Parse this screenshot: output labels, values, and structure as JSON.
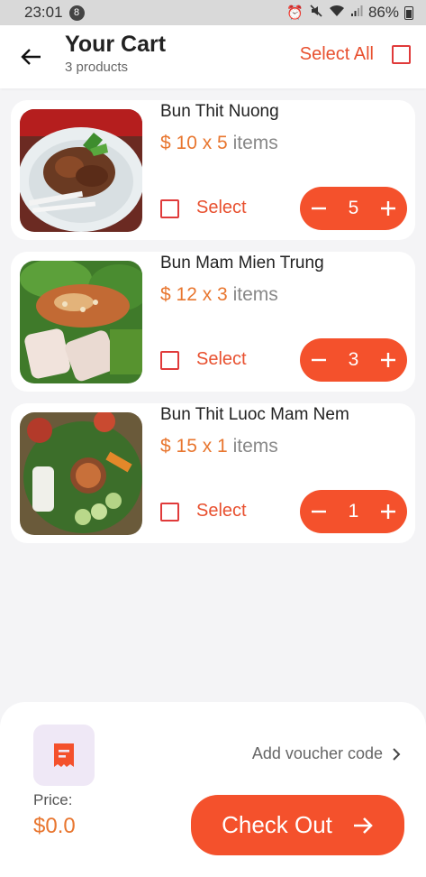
{
  "status_bar": {
    "time": "23:01",
    "notification_count": "8",
    "battery": "86%",
    "icons": [
      "alarm-icon",
      "mute-icon",
      "wifi-icon",
      "signal-icon",
      "battery-icon"
    ]
  },
  "header": {
    "back_icon": "arrow-left-icon",
    "title": "Your Cart",
    "subtitle": "3 products",
    "select_all_label": "Select All"
  },
  "items": [
    {
      "name": "Bun Thit Nuong",
      "currency": "$",
      "price": "10",
      "quantity": "5",
      "select_label": "Select",
      "items_word": "items",
      "price_line": "$ 10 x 5"
    },
    {
      "name": "Bun Mam Mien Trung",
      "currency": "$",
      "price": "12",
      "quantity": "3",
      "select_label": "Select",
      "items_word": "items",
      "price_line": "$ 12 x 3"
    },
    {
      "name": "Bun Thit Luoc Mam Nem",
      "currency": "$",
      "price": "15",
      "quantity": "1",
      "select_label": "Select",
      "items_word": "items",
      "price_line": "$ 15 x 1"
    }
  ],
  "footer": {
    "voucher_label": "Add voucher code",
    "price_label": "Price:",
    "price_value": "$0.0",
    "checkout_label": "Check Out"
  },
  "colors": {
    "accent": "#f4512c",
    "price": "#e8762f",
    "checkbox": "#e03a3a",
    "voucher_bg": "#efe8f6"
  }
}
